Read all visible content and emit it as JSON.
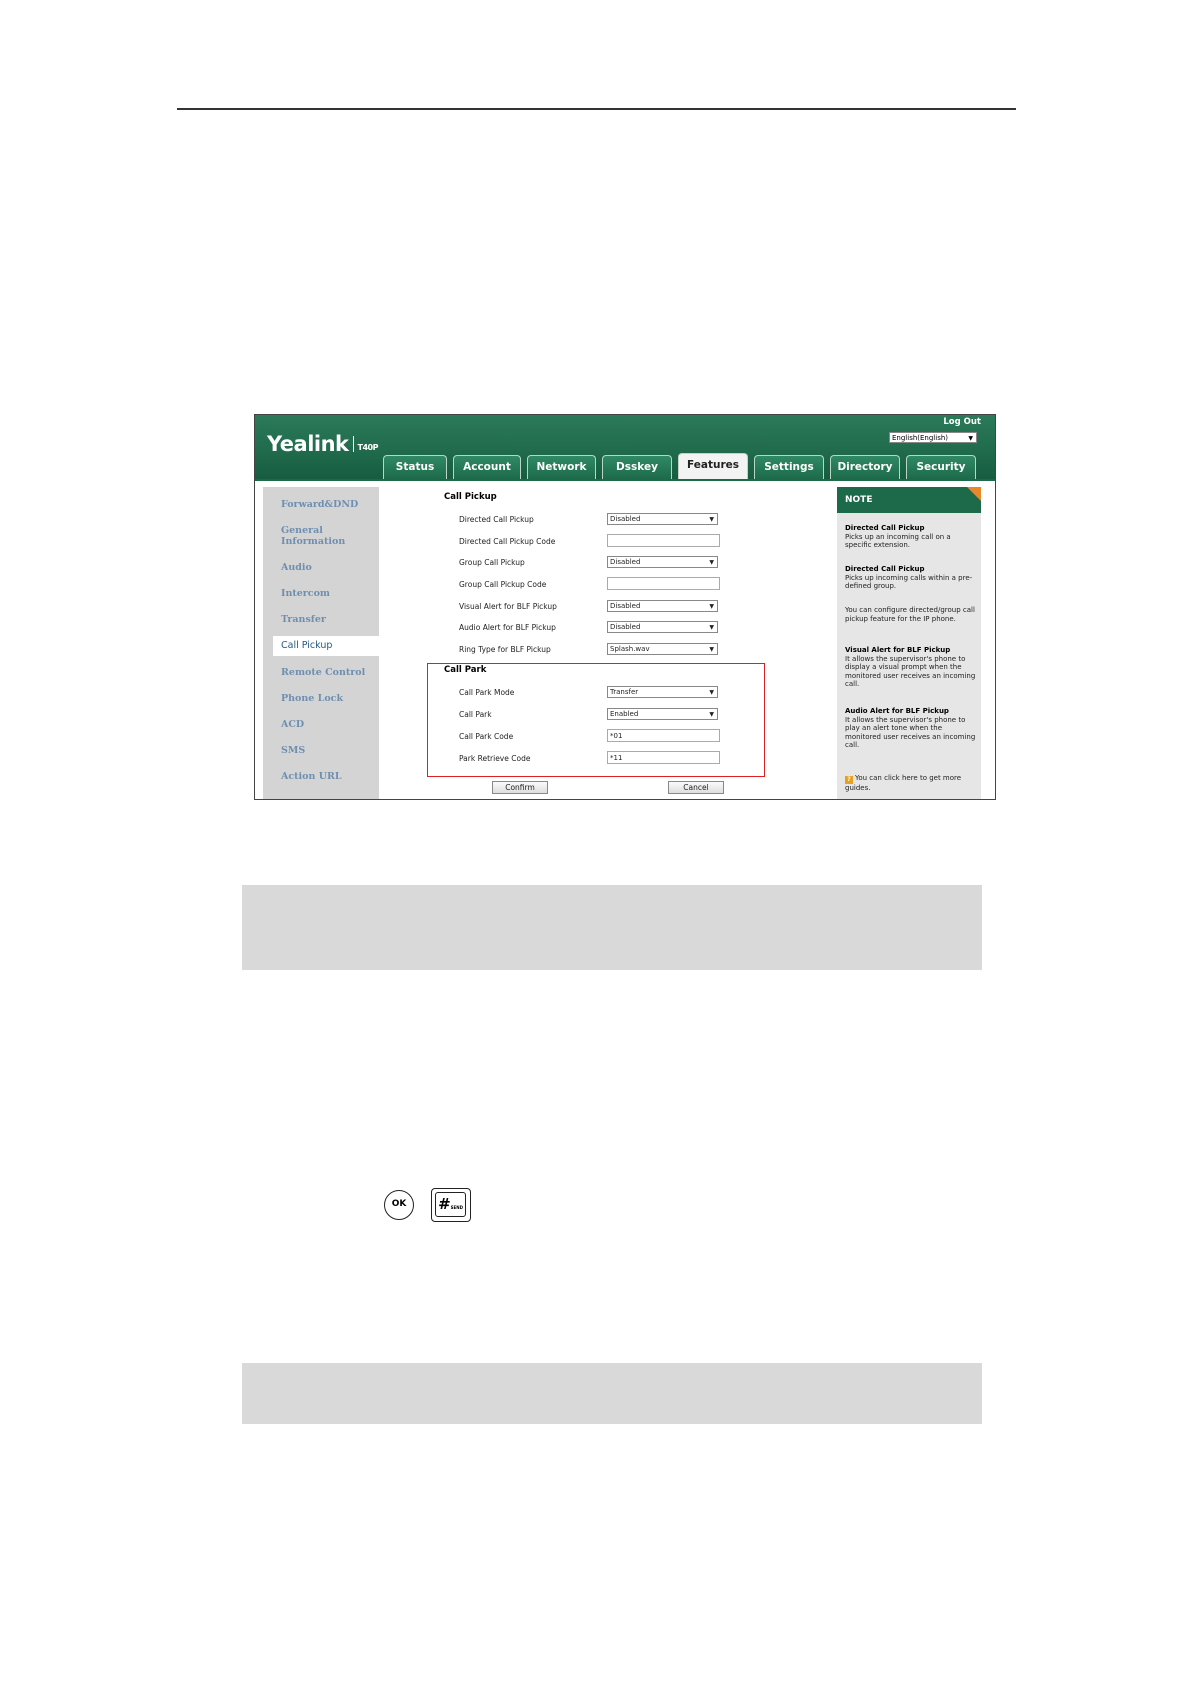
{
  "brand": {
    "name": "Yealink",
    "model": "T40P"
  },
  "header": {
    "logout": "Log Out",
    "language": "English(English)"
  },
  "tabs": [
    {
      "label": "Status",
      "active": false
    },
    {
      "label": "Account",
      "active": false
    },
    {
      "label": "Network",
      "active": false
    },
    {
      "label": "Dsskey",
      "active": false
    },
    {
      "label": "Features",
      "active": true
    },
    {
      "label": "Settings",
      "active": false
    },
    {
      "label": "Directory",
      "active": false
    },
    {
      "label": "Security",
      "active": false
    }
  ],
  "sidebar": {
    "items": [
      "Forward&DND",
      "General Information",
      "Audio",
      "Intercom",
      "Transfer",
      "Call Pickup",
      "Remote Control",
      "Phone Lock",
      "ACD",
      "SMS",
      "Action URL"
    ],
    "active": "Call Pickup"
  },
  "call_pickup": {
    "title": "Call Pickup",
    "fields": [
      {
        "label": "Directed Call Pickup",
        "type": "select",
        "value": "Disabled"
      },
      {
        "label": "Directed Call Pickup Code",
        "type": "input",
        "value": ""
      },
      {
        "label": "Group Call Pickup",
        "type": "select",
        "value": "Disabled"
      },
      {
        "label": "Group Call Pickup Code",
        "type": "input",
        "value": ""
      },
      {
        "label": "Visual Alert for BLF Pickup",
        "type": "select",
        "value": "Disabled"
      },
      {
        "label": "Audio Alert for BLF Pickup",
        "type": "select",
        "value": "Disabled"
      },
      {
        "label": "Ring Type for BLF Pickup",
        "type": "select",
        "value": "Splash.wav"
      }
    ]
  },
  "call_park": {
    "title": "Call Park",
    "fields": [
      {
        "label": "Call Park Mode",
        "type": "select",
        "value": "Transfer"
      },
      {
        "label": "Call Park",
        "type": "select",
        "value": "Enabled"
      },
      {
        "label": "Call Park Code",
        "type": "input",
        "value": "*01"
      },
      {
        "label": "Park Retrieve Code",
        "type": "input",
        "value": "*11"
      }
    ]
  },
  "buttons": {
    "confirm": "Confirm",
    "cancel": "Cancel"
  },
  "note": {
    "title": "NOTE",
    "blocks": [
      {
        "heading": "Directed Call Pickup",
        "text": "Picks up an incoming call on a specific extension."
      },
      {
        "heading": "Directed Call Pickup",
        "text": "Picks up incoming calls within a pre-defined group."
      },
      {
        "heading": "",
        "text": "You can configure directed/group call pickup feature for the IP phone."
      },
      {
        "heading": "Visual Alert for BLF Pickup",
        "text": "It allows the supervisor's phone to display a visual prompt when the monitored user receives an incoming call."
      },
      {
        "heading": "Audio Alert for BLF Pickup",
        "text": "It allows the supervisor's phone to play an alert tone when the monitored user receives an incoming call."
      }
    ],
    "link": "You can click here to get more guides."
  },
  "keys": {
    "ok": "OK",
    "hash": "#",
    "hash_sub": "SEND"
  }
}
